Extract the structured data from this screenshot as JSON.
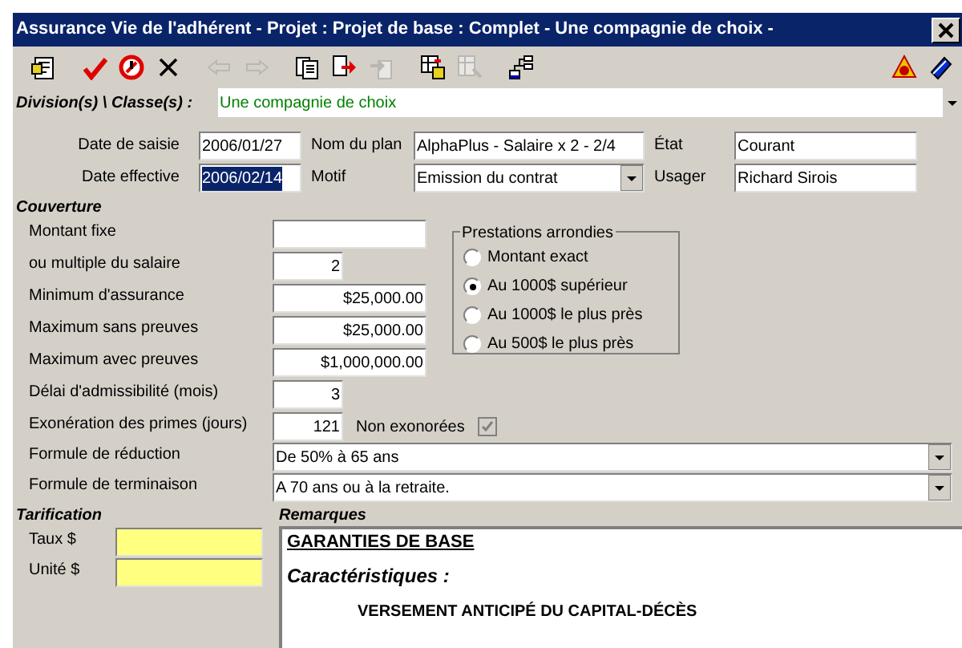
{
  "window": {
    "title": "Assurance Vie de l'adhérent - Projet : Projet de base : Complet - Une compagnie de choix -"
  },
  "toolbar": {
    "left_groups": [
      [
        {
          "kind": "notes",
          "disabled": false
        }
      ],
      [
        {
          "kind": "check",
          "disabled": false
        },
        {
          "kind": "stop",
          "disabled": false
        },
        {
          "kind": "cross",
          "disabled": false
        }
      ],
      [
        {
          "kind": "left",
          "disabled": true
        },
        {
          "kind": "right",
          "disabled": true
        }
      ],
      [
        {
          "kind": "pages",
          "disabled": false
        },
        {
          "kind": "export",
          "disabled": false
        },
        {
          "kind": "import",
          "disabled": true
        }
      ],
      [
        {
          "kind": "gridout",
          "disabled": false
        },
        {
          "kind": "gridin",
          "disabled": true
        }
      ],
      [
        {
          "kind": "tree",
          "disabled": false
        }
      ]
    ],
    "right": [
      {
        "kind": "help",
        "disabled": false
      },
      {
        "kind": "book",
        "disabled": false
      }
    ]
  },
  "division": {
    "label": "Division(s) \\ Classe(s) :",
    "value": "Une compagnie de choix"
  },
  "header_fields": [
    {
      "label": "Date de saisie",
      "value": "2006/01/27",
      "selected": false
    },
    {
      "label": "Nom du plan",
      "value": "AlphaPlus - Salaire x 2 - 2/4",
      "kind": "text"
    },
    {
      "label": "État",
      "value": "Courant"
    },
    {
      "label": "Date effective",
      "value": "2006/02/14",
      "selected": true
    },
    {
      "label": "Motif",
      "value": "Emission du contrat",
      "kind": "dropdown"
    },
    {
      "label": "Usager",
      "value": "Richard Sirois"
    }
  ],
  "coverage": {
    "title": "Couverture",
    "fields": [
      {
        "label": "Montant fixe",
        "wide": true
      },
      {
        "label": "ou multiple du salaire",
        "value": "2",
        "wide": false
      },
      {
        "label": "Minimum d'assurance",
        "value": "$25,000.00",
        "wide": true
      },
      {
        "label": "Maximum sans preuves",
        "value": "$25,000.00",
        "wide": true
      },
      {
        "label": "Maximum avec preuves",
        "value": "$1,000,000.00",
        "wide": true
      },
      {
        "label": "Délai d'admissibilité (mois)",
        "value": "3",
        "wide": false
      },
      {
        "label": "Exonération des primes (jours)",
        "value": "121",
        "wide": false
      }
    ],
    "non_exonerees": {
      "label": "Non exonorées",
      "checked": true,
      "disabled": true
    },
    "rounding": {
      "title": "Prestations arrondies",
      "options": [
        {
          "label": "Montant exact",
          "selected": false
        },
        {
          "label": "Au 1000$ supérieur",
          "selected": true
        },
        {
          "label": "Au 1000$ le plus près",
          "selected": false
        },
        {
          "label": "Au 500$ le plus près",
          "selected": false
        }
      ]
    },
    "formulas": [
      {
        "label": "Formule de réduction",
        "value": "De 50% à 65 ans"
      },
      {
        "label": "Formule de terminaison",
        "value": "A 70 ans ou à la retraite."
      }
    ]
  },
  "pricing": {
    "title": "Tarification",
    "fields": [
      {
        "label": "Taux $"
      },
      {
        "label": "Unité $"
      }
    ]
  },
  "remarks": {
    "title": "Remarques",
    "blocks": [
      {
        "kind": "heading",
        "text": "GARANTIES DE BASE"
      },
      {
        "kind": "subheading",
        "text": "Caractéristiques :"
      },
      {
        "kind": "item",
        "text": "VERSEMENT ANTICIPÉ DU CAPITAL-DÉCÈS"
      }
    ]
  }
}
